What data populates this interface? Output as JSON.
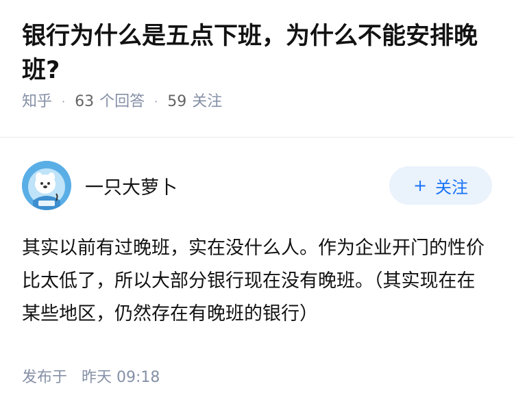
{
  "question": {
    "title": "银行为什么是五点下班，为什么不能安排晚班?",
    "source": "知乎",
    "answer_count": "63",
    "answer_label": "个回答",
    "follow_count": "59",
    "follow_label": "关注"
  },
  "answer": {
    "author_name": "一只大萝卜",
    "avatar_icon": "avatar-image",
    "follow_button_label": "关注",
    "follow_button_icon": "plus-icon",
    "content_paragraph": "其实以前有过晚班，实在没什么人。作为企业开门的性价比太低了，所以大部分银行现在没有晚班。（其实现在在某些地区，仍然存在有晚班的银行）",
    "publish_label": "发布于",
    "publish_time": "昨天 09:18"
  },
  "colors": {
    "accent": "#1772f6",
    "follow_bg": "#eaf2fc",
    "meta_gray": "#8590a6",
    "text": "#121212",
    "avatar_bg": "#5aaee6"
  }
}
